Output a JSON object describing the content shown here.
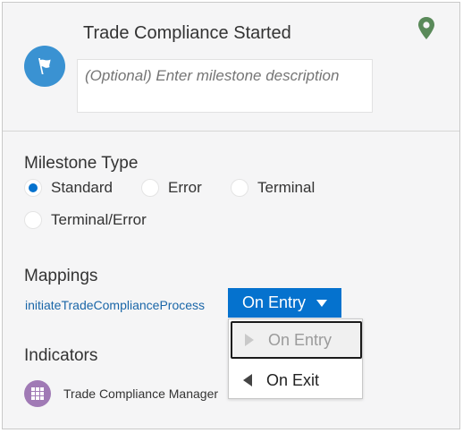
{
  "header": {
    "title": "Trade Compliance Started",
    "description_placeholder": "(Optional) Enter milestone description",
    "description_value": "",
    "avatar_icon": "flag-icon",
    "pin_icon": "location-pin-icon",
    "accent_color": "#3a92d2",
    "pin_color": "#5a8a5a"
  },
  "milestone_type": {
    "label": "Milestone Type",
    "options": [
      {
        "label": "Standard",
        "selected": true
      },
      {
        "label": "Error",
        "selected": false
      },
      {
        "label": "Terminal",
        "selected": false
      },
      {
        "label": "Terminal/Error",
        "selected": false
      }
    ]
  },
  "mappings": {
    "label": "Mappings",
    "link_text": "initiateTradeComplianceProcess",
    "dropdown": {
      "selected_label": "On Entry",
      "options": [
        {
          "label": "On Entry",
          "disabled": true,
          "icon": "triangle-right-icon"
        },
        {
          "label": "On Exit",
          "disabled": false,
          "icon": "triangle-left-icon"
        }
      ],
      "button_color": "#0572ce"
    }
  },
  "indicators": {
    "label": "Indicators",
    "items": [
      {
        "label": "Trade Compliance Manager",
        "icon": "grid-icon",
        "icon_color": "#a07ab5"
      }
    ]
  }
}
